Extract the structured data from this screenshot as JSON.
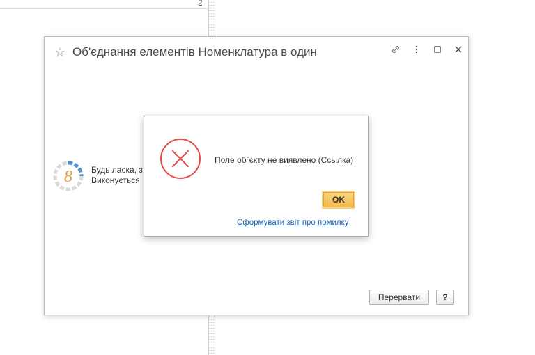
{
  "background": {
    "row_number": "2"
  },
  "window": {
    "title": "Об'єднання елементів Номенклатура в один",
    "controls": [
      "link-icon",
      "more-icon",
      "maximize-icon",
      "close-icon"
    ],
    "wait_line1": "Будь ласка, з",
    "wait_line2": "Виконується",
    "abort_label": "Перервати",
    "help_label": "?"
  },
  "dialog": {
    "message": "Поле об`єкту не виявлено (Ссылка)",
    "ok_label": "OK",
    "report_link": "Сформувати звіт про помилку"
  },
  "colors": {
    "accent_button": "#f2b84b",
    "error_red": "#e84a4a",
    "link": "#1a5fb4"
  }
}
